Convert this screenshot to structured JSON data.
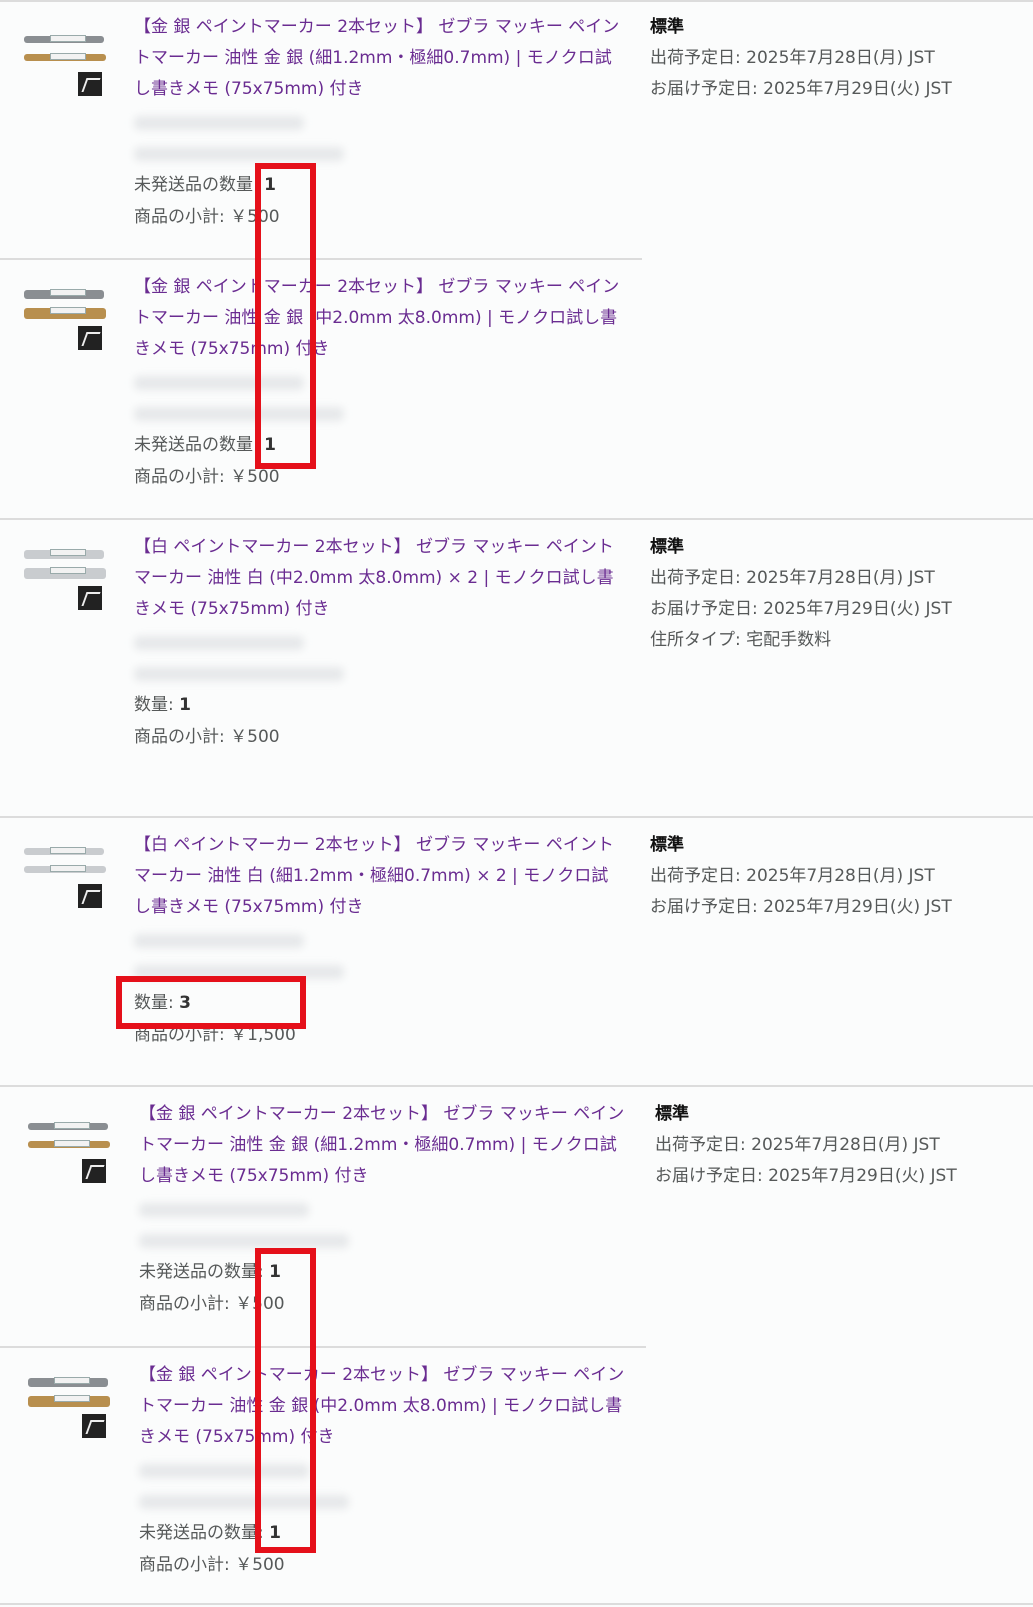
{
  "items": [
    {
      "title": "【金 銀 ペイントマーカー 2本セット】 ゼブラ マッキー ペイントマーカー 油性 金 銀 (細1.2mm・極細0.7mm) | モノクロ試し書きメモ (75x75mm) 付き",
      "qty_label": "未発送品の数量:",
      "qty_value": "1",
      "subtotal_label": "商品の小計:",
      "subtotal_value": "￥500"
    },
    {
      "title": "【金 銀 ペイントマーカー 2本セット】 ゼブラ マッキー ペイントマーカー 油性 金 銀 (中2.0mm 太8.0mm) | モノクロ試し書きメモ (75x75mm) 付き",
      "qty_label": "未発送品の数量:",
      "qty_value": "1",
      "subtotal_label": "商品の小計:",
      "subtotal_value": "￥500"
    },
    {
      "title": "【白 ペイントマーカー 2本セット】 ゼブラ マッキー ペイントマーカー 油性 白 (中2.0mm 太8.0mm) × 2 | モノクロ試し書きメモ (75x75mm) 付き",
      "qty_label": "数量:",
      "qty_value": "1",
      "subtotal_label": "商品の小計:",
      "subtotal_value": "￥500"
    },
    {
      "title": "【白 ペイントマーカー 2本セット】 ゼブラ マッキー ペイントマーカー 油性 白 (細1.2mm・極細0.7mm) × 2 | モノクロ試し書きメモ (75x75mm) 付き",
      "qty_label": "数量:",
      "qty_value": "3",
      "subtotal_label": "商品の小計:",
      "subtotal_value": "￥1,500"
    },
    {
      "title": "【金 銀 ペイントマーカー 2本セット】 ゼブラ マッキー ペイントマーカー 油性 金 銀 (細1.2mm・極細0.7mm) | モノクロ試し書きメモ (75x75mm) 付き",
      "qty_label": "未発送品の数量:",
      "qty_value": "1",
      "subtotal_label": "商品の小計:",
      "subtotal_value": "￥500"
    },
    {
      "title": "【金 銀 ペイントマーカー 2本セット】 ゼブラ マッキー ペイントマーカー 油性 金 銀 (中2.0mm 太8.0mm) | モノクロ試し書きメモ (75x75mm) 付き",
      "qty_label": "未発送品の数量:",
      "qty_value": "1",
      "subtotal_label": "商品の小計:",
      "subtotal_value": "￥500"
    }
  ],
  "shipping": [
    {
      "method": "標準",
      "ship_date": "出荷予定日: 2025年7月28日(月) JST",
      "delivery_date": "お届け予定日: 2025年7月29日(火) JST"
    },
    {
      "method": "標準",
      "ship_date": "出荷予定日: 2025年7月28日(月) JST",
      "delivery_date": "お届け予定日: 2025年7月29日(火) JST",
      "address_type": "住所タイプ: 宅配手数料"
    },
    {
      "method": "標準",
      "ship_date": "出荷予定日: 2025年7月28日(月) JST",
      "delivery_date": "お届け予定日: 2025年7月29日(火) JST"
    },
    {
      "method": "標準",
      "ship_date": "出荷予定日: 2025年7月28日(月) JST",
      "delivery_date": "お届け予定日: 2025年7月29日(火) JST"
    }
  ],
  "colors": {
    "link": "#6a2c91",
    "text": "#565959",
    "highlight": "#e5101a",
    "divider": "#dcdcdc"
  }
}
